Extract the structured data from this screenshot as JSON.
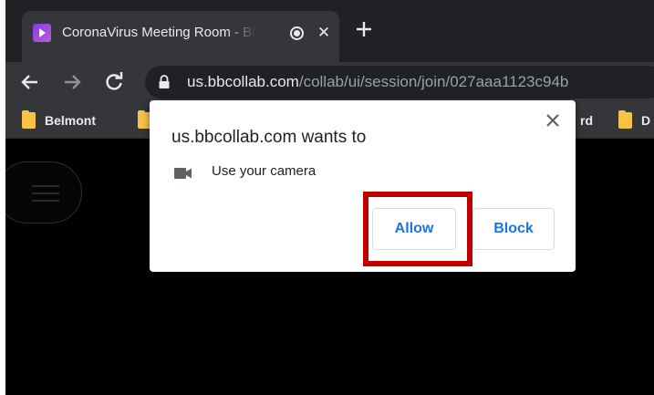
{
  "tab": {
    "title": "CoronaVirus Meeting Room - Blackboard Collaborate Ultra",
    "favicon": "collaborate-logo-icon",
    "recording_icon": "recording-icon",
    "close_label": "✕",
    "new_tab_icon": "plus-icon"
  },
  "toolbar": {
    "back_icon": "back-arrow-icon",
    "forward_icon": "forward-arrow-icon",
    "reload_icon": "reload-icon",
    "lock_icon": "lock-icon",
    "url_host": "us.bbcollab.com",
    "url_path": "/collab/ui/session/join/027aaa1123c94b"
  },
  "bookmarks": [
    {
      "label": "Belmont"
    },
    {
      "label": "rd"
    },
    {
      "label": "D"
    }
  ],
  "popup": {
    "title": "us.bbcollab.com wants to",
    "permission_icon": "camera-icon",
    "permission_label": "Use your camera",
    "allow_label": "Allow",
    "block_label": "Block",
    "close_icon": "close-icon"
  },
  "annotation": {
    "highlight_color": "#c00000",
    "target": "Allow"
  },
  "colors": {
    "tab_strip": "#202124",
    "toolbar": "#35363a",
    "button_text": "#1a73e8",
    "folder": "#f6c344"
  }
}
